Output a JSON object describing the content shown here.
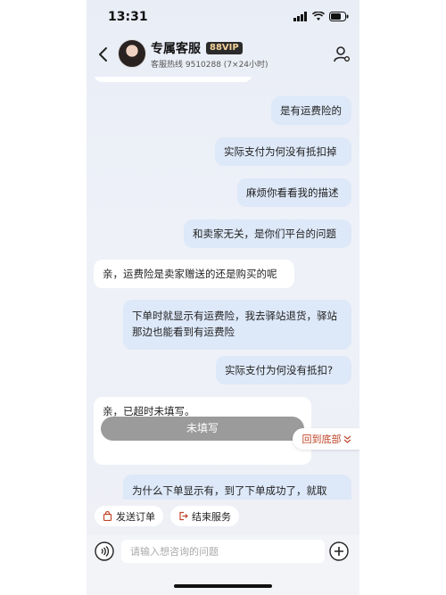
{
  "status_bar": {
    "time": "13:31"
  },
  "header": {
    "title": "专属客服",
    "vip_badge": "88VIP",
    "hotline": "客服热线 9510288 (7×24小时)"
  },
  "messages": [
    {
      "side": "me",
      "text": "是有运费险的"
    },
    {
      "side": "me",
      "text": "实际支付为何没有抵扣掉"
    },
    {
      "side": "me",
      "text": "麻烦你看看我的描述"
    },
    {
      "side": "me",
      "text": "和卖家无关，是你们平台的问题"
    },
    {
      "side": "them",
      "text": "亲，运费险是卖家赠送的还是购买的呢"
    },
    {
      "side": "me",
      "text": "下单时就显示有运费险，我去驿站退货，驿站那边也能看到有运费险"
    },
    {
      "side": "me",
      "text": "实际支付为何没有抵扣?"
    },
    {
      "side": "them",
      "text": "亲，已超时未填写。",
      "button": "未填写"
    },
    {
      "side": "me",
      "text": "为什么下单显示有，到了下单成功了，就取"
    }
  ],
  "scroll_to_bottom": "回到底部",
  "quick_actions": [
    {
      "label": "发送订单",
      "icon": "bag-icon"
    },
    {
      "label": "结束服务",
      "icon": "exit-icon"
    }
  ],
  "composer": {
    "placeholder": "请输入想咨询的问题"
  },
  "colors": {
    "my_bubble": "#dde8f8",
    "their_bubble": "#ffffff",
    "accent_red": "#c0462a"
  }
}
